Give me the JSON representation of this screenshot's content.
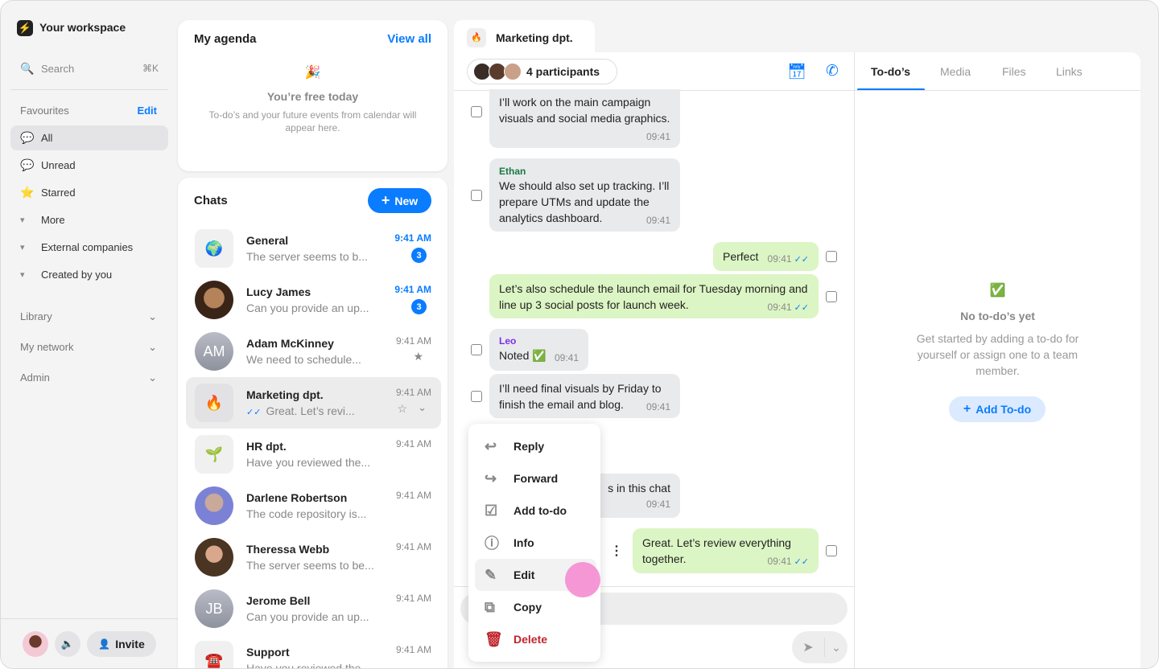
{
  "sidebar": {
    "workspace": "Your workspace",
    "search": "Search",
    "search_shortcut": "⌘K",
    "favourites": "Favourites",
    "edit": "Edit",
    "items": [
      {
        "label": "All",
        "icon": "💬"
      },
      {
        "label": "Unread",
        "icon": "💬"
      },
      {
        "label": "Starred",
        "icon": "⭐"
      },
      {
        "label": "More",
        "icon": "▾"
      },
      {
        "label": "External companies",
        "icon": "▾"
      },
      {
        "label": "Created by you",
        "icon": "▾"
      }
    ],
    "sections": [
      {
        "label": "Library"
      },
      {
        "label": "My network"
      },
      {
        "label": "Admin"
      }
    ],
    "invite": "Invite"
  },
  "agenda": {
    "title": "My agenda",
    "view_all": "View all",
    "emoji": "🎉",
    "empty_title": "You’re free today",
    "empty_desc": "To-do’s and your future events from calendar will appear here."
  },
  "chats": {
    "title": "Chats",
    "new": "New",
    "rows": [
      {
        "name": "General",
        "preview": "The server seems to b...",
        "time": "9:41 AM",
        "badge": "3",
        "avatar": "🌍"
      },
      {
        "name": "Lucy James",
        "preview": "Can you provide an up...",
        "time": "9:41 AM",
        "badge": "3",
        "avatar": ""
      },
      {
        "name": "Adam McKinney",
        "preview": "We need to schedule...",
        "time": "9:41 AM",
        "avatar": "AM"
      },
      {
        "name": "Marketing dpt.",
        "preview": "Great. Let’s revi...",
        "time": "9:41 AM",
        "avatar": "🔥"
      },
      {
        "name": "HR dpt.",
        "preview": "Have you reviewed the...",
        "time": "9:41 AM",
        "avatar": "🌱"
      },
      {
        "name": "Darlene Robertson",
        "preview": "The code repository is...",
        "time": "9:41 AM",
        "avatar": ""
      },
      {
        "name": "Theressa Webb",
        "preview": "The server seems to be...",
        "time": "9:41 AM",
        "avatar": ""
      },
      {
        "name": "Jerome Bell",
        "preview": "Can you provide an up...",
        "time": "9:41 AM",
        "avatar": "JB"
      },
      {
        "name": "Support",
        "preview": "Have you reviewed the...",
        "time": "9:41 AM",
        "avatar": "☎️"
      }
    ]
  },
  "conversation": {
    "tab": "Marketing dpt.",
    "tab_icon": "🔥",
    "participants": "4 participants",
    "messages": [
      {
        "text": "I’ll work on the main campaign visuals and social media graphics.",
        "time": "09:41"
      },
      {
        "sender": "Ethan",
        "text": "We should also set up tracking. I’ll prepare UTMs and update the analytics dashboard.",
        "time": "09:41"
      },
      {
        "text": "Perfect",
        "time": "09:41"
      },
      {
        "text": "Let’s also schedule the launch email for Tuesday morning and line up 3 social posts for launch week.",
        "time": "09:41"
      },
      {
        "sender": "Leo",
        "text": "Noted ✅",
        "time": "09:41"
      },
      {
        "text": "I’ll need final visuals by Friday to finish the email and blog.",
        "time": "09:41"
      },
      {
        "text": "s in this chat",
        "time": "09:41"
      },
      {
        "text": "Great. Let’s review everything together.",
        "time": "09:41"
      }
    ]
  },
  "context_menu": {
    "items": [
      {
        "label": "Reply",
        "icon": "↩"
      },
      {
        "label": "Forward",
        "icon": "↪"
      },
      {
        "label": "Add to-do",
        "icon": "☑"
      },
      {
        "label": "Info",
        "icon": "ⓘ"
      },
      {
        "label": "Edit",
        "icon": "✎"
      },
      {
        "label": "Copy",
        "icon": "⧉"
      },
      {
        "label": "Delete",
        "icon": "🗑"
      }
    ]
  },
  "right_panel": {
    "tabs": [
      "To-do’s",
      "Media",
      "Files",
      "Links"
    ],
    "emoji": "✅",
    "empty_title": "No to-do’s yet",
    "empty_desc": "Get started by adding a to-do for yourself or assign one to a team member.",
    "add": "Add To-do"
  },
  "colors": {
    "accent": "#0a7cff",
    "delete": "#c0262d",
    "outgoing": "#dcf5c4",
    "incoming": "#e9eaec",
    "ethan": "#1a7a45",
    "leo": "#7b2ff0"
  }
}
